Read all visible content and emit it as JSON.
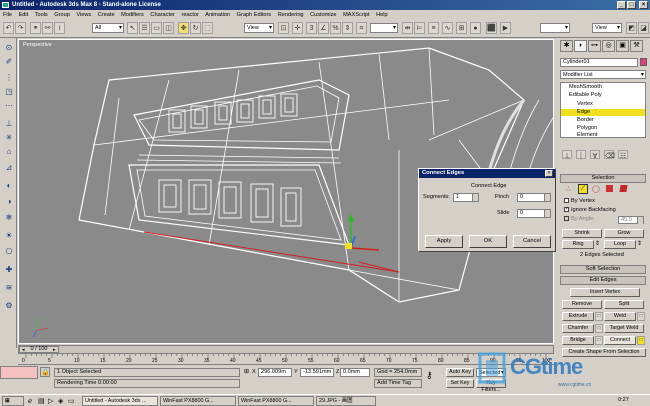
{
  "window": {
    "title": "Untitled - Autodesk 3ds Max 8 - Stand-alone License"
  },
  "menu": [
    "File",
    "Edit",
    "Tools",
    "Group",
    "Views",
    "Create",
    "Modifiers",
    "Character",
    "reactor",
    "Animation",
    "Graph Editors",
    "Rendering",
    "Customize",
    "MAXScript",
    "Help"
  ],
  "toolbar": {
    "selection_filter": "All",
    "coord_system": "View",
    "coord_system_2": "View"
  },
  "viewport": {
    "label": "Perspective"
  },
  "dialog": {
    "title": "Connect Edges",
    "group_label": "Connect Edge",
    "segments_label": "Segments:",
    "segments_value": "1",
    "pinch_label": "Pinch",
    "pinch_value": "0",
    "slide_label": "Slide",
    "slide_value": "0",
    "apply": "Apply",
    "ok": "OK",
    "cancel": "Cancel"
  },
  "panel": {
    "object_name": "Cylinder01",
    "modifier_list": "Modifier List",
    "stack": [
      "MeshSmooth",
      "Editable Poly",
      "Vertex",
      "Edge",
      "Border",
      "Polygon",
      "Element"
    ],
    "selection_head": "Selection",
    "by_vertex": "By Vertex",
    "ignore_backfacing": "Ignore Backfacing",
    "by_angle": "By Angle:",
    "by_angle_value": "45.0",
    "shrink": "Shrink",
    "grow": "Grow",
    "ring": "Ring",
    "loop": "Loop",
    "selected_info": "2 Edges Selected",
    "soft_selection": "Soft Selection",
    "edit_edges": "Edit Edges",
    "insert_vertex": "Insert Vertex",
    "remove": "Remove",
    "split": "Split",
    "extrude": "Extrude",
    "weld": "Weld",
    "chamfer": "Chamfer",
    "target_weld": "Target Weld",
    "bridge": "Bridge",
    "connect": "Connect",
    "create_shape": "Create Shape From Selection"
  },
  "timeline": {
    "frame": "0 / 100",
    "ticks": [
      "0",
      "5",
      "10",
      "15",
      "20",
      "25",
      "30",
      "35",
      "40",
      "45",
      "50",
      "55",
      "60",
      "65",
      "70",
      "75",
      "80",
      "85",
      "90",
      "95",
      "100"
    ]
  },
  "status": {
    "selected": "1 Object Selected",
    "render_time": "Rendering Time  0:00:00",
    "x": "296.009m",
    "y": "-13.591mm",
    "z": "0.0mm",
    "grid": "Grid = 254.0mm",
    "add_time_tag": "Add Time Tag",
    "auto_key": "Auto Key",
    "set_key": "Set Key",
    "selected_dd": "Selected",
    "key_filters": "Key Filters..."
  },
  "taskbar": {
    "tasks": [
      "Untitled - Autodesk 3ds ...",
      "WinFast PX8800 G...",
      "WinFast PX8800 G...",
      "29.JPG - 画图"
    ],
    "clock": "0:27"
  },
  "watermark": {
    "text": "CGtime",
    "url": "www.cgtime.cn"
  }
}
